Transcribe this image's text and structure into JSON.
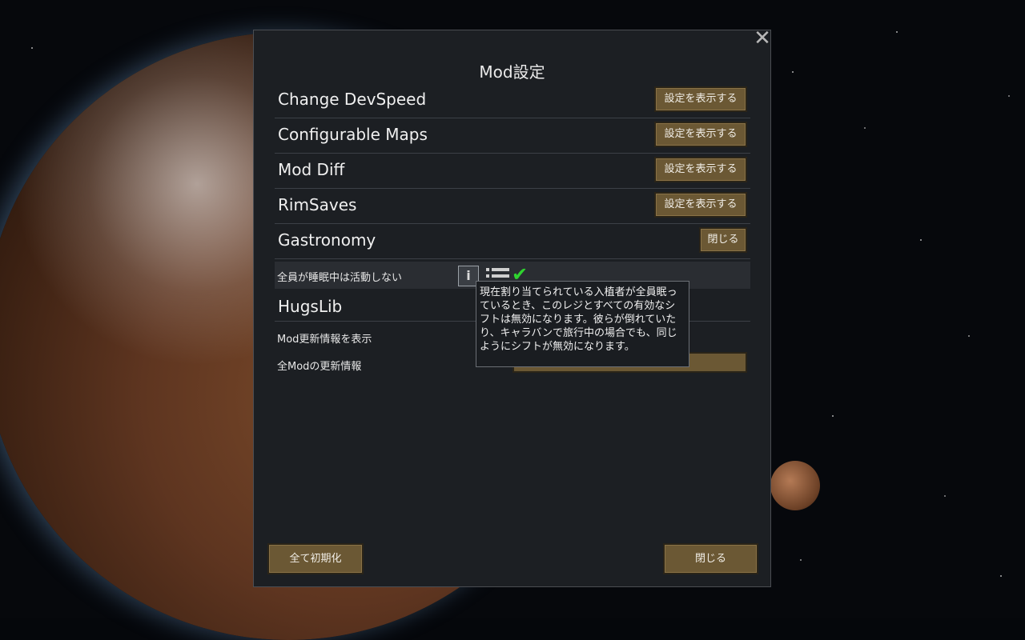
{
  "window": {
    "title": "Mod設定",
    "close_icon": "close-icon"
  },
  "mods": [
    {
      "name": "Change DevSpeed",
      "button": "設定を表示する"
    },
    {
      "name": "Configurable Maps",
      "button": "設定を表示する"
    },
    {
      "name": "Mod Diff",
      "button": "設定を表示する"
    },
    {
      "name": "RimSaves",
      "button": "設定を表示する"
    },
    {
      "name": "Gastronomy",
      "button": "閉じる"
    }
  ],
  "gastronomy_setting": {
    "label": "全員が睡眠中は活動しない",
    "checked": true,
    "tooltip": "現在割り当てられている入植者が全員眠っているとき、このレジとすべての有効なシフトは無効になります。彼らが倒れていたり、キャラバンで旅行中の場合でも、同じようにシフトが無効になります。"
  },
  "hugslib": {
    "name": "HugsLib",
    "show_update_info": "Mod更新情報を表示",
    "all_mod_updates": "全Modの更新情報"
  },
  "footer": {
    "reset_all": "全て初期化",
    "close": "閉じる"
  },
  "colors": {
    "button_bg": "#6b5834",
    "check": "#2fd32f",
    "dialog_bg": "#1c1f23"
  }
}
